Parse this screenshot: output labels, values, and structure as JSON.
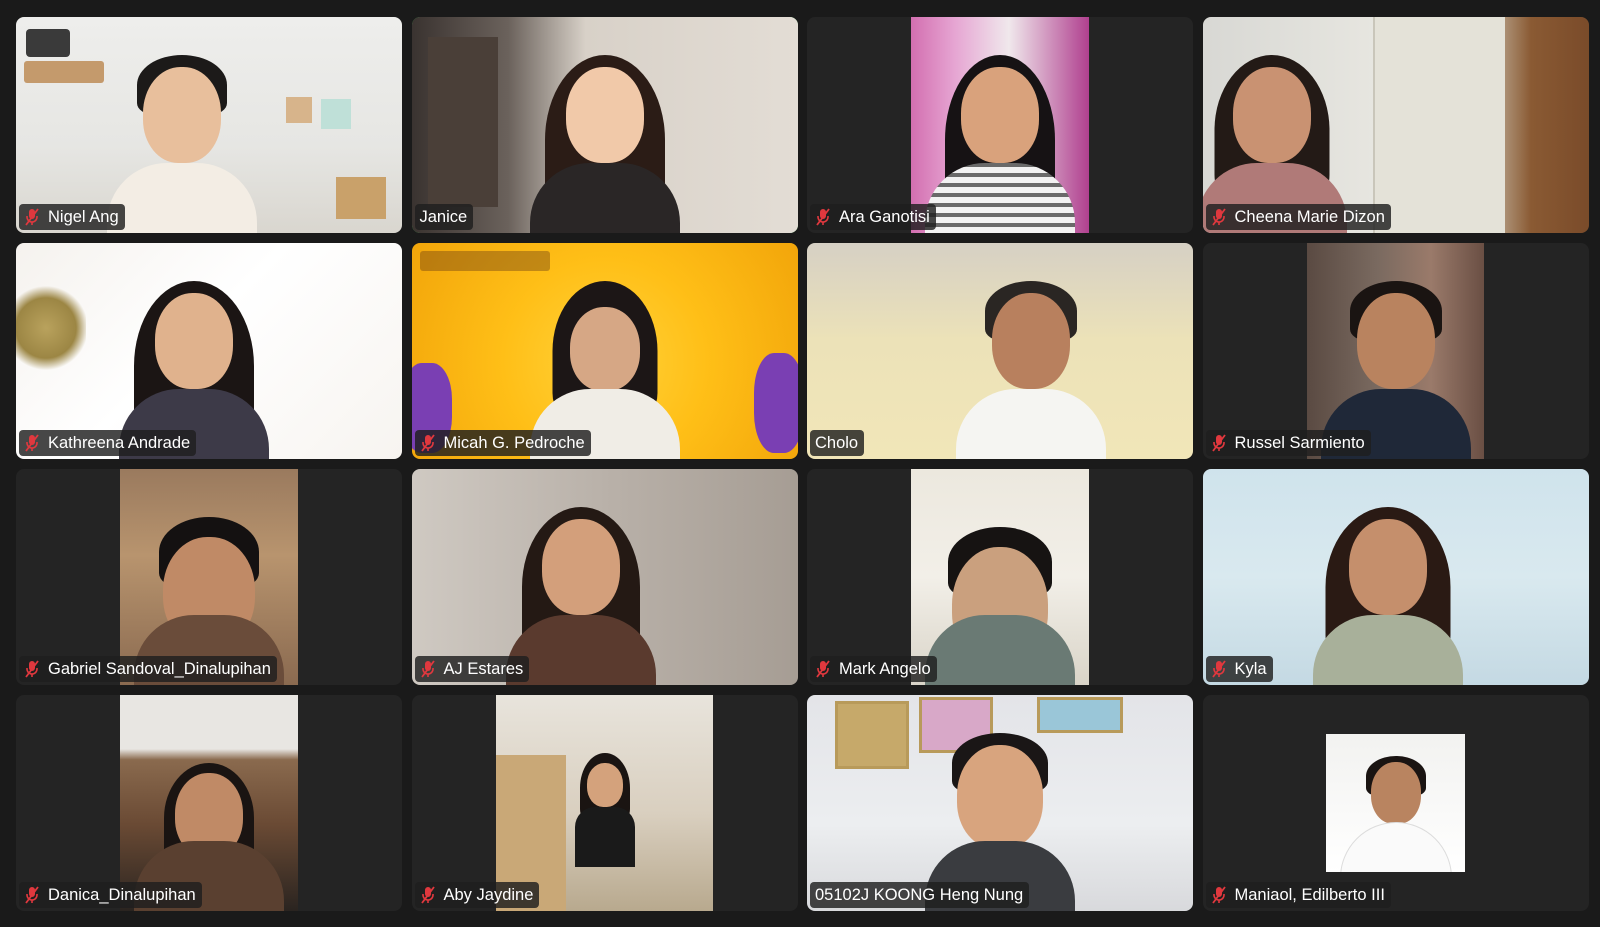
{
  "colors": {
    "background": "#1a1a1a",
    "tile": "#242424",
    "active_speaker_border": "#3cc456",
    "muted_icon": "#e0383e"
  },
  "participants": [
    {
      "name": "Nigel Ang",
      "muted": true
    },
    {
      "name": "Janice",
      "muted": false,
      "active_speaker": true
    },
    {
      "name": "Ara Ganotisi",
      "muted": true
    },
    {
      "name": "Cheena Marie Dizon",
      "muted": true
    },
    {
      "name": "Kathreena Andrade",
      "muted": true
    },
    {
      "name": "Micah G. Pedroche",
      "muted": true
    },
    {
      "name": "Cholo",
      "muted": false
    },
    {
      "name": "Russel Sarmiento",
      "muted": true
    },
    {
      "name": "Gabriel Sandoval_Dinalupihan",
      "muted": true
    },
    {
      "name": "AJ Estares",
      "muted": true
    },
    {
      "name": "Mark Angelo",
      "muted": true
    },
    {
      "name": "Kyla",
      "muted": true
    },
    {
      "name": "Danica_Dinalupihan",
      "muted": true
    },
    {
      "name": "Aby Jaydine",
      "muted": true
    },
    {
      "name": "05102J KOONG Heng Nung",
      "muted": false
    },
    {
      "name": "Maniaol, Edilberto III",
      "muted": true
    }
  ]
}
